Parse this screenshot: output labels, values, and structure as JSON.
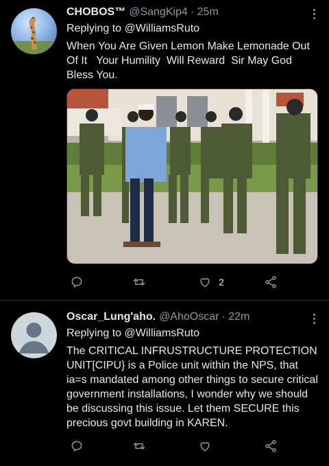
{
  "tweets": [
    {
      "display_name": "CHOBOS™",
      "handle": "@SangKip4",
      "time": "· 25m",
      "replying_to": "Replying to @WilliamsRuto",
      "text": "When You Are Given Lemon Make Lemonade Out Of It   Your Humility  Will Reward  Sir May God Bless You.",
      "has_media": true,
      "likes": "2"
    },
    {
      "display_name": "Oscar_Lung'aho.",
      "handle": "@AhoOscar",
      "time": "· 22m",
      "replying_to": "Replying to @WilliamsRuto",
      "text": "The CRITICAL INFRUSTRUCTURE PROTECTION UNIT[CIPU} is a Police unit within the NPS, that ia=s mandated among other things to secure critical government installations, I wonder why we should be discussing this issue. Let them SECURE this precious govt building in KAREN.",
      "has_media": false,
      "likes": ""
    }
  ],
  "colors": {
    "background": "#000000",
    "text": "#e7e9ea",
    "muted": "#8b98a5",
    "divider": "#2f3336"
  },
  "icons": [
    "reply-icon",
    "retweet-icon",
    "like-icon",
    "share-icon",
    "more-icon"
  ]
}
